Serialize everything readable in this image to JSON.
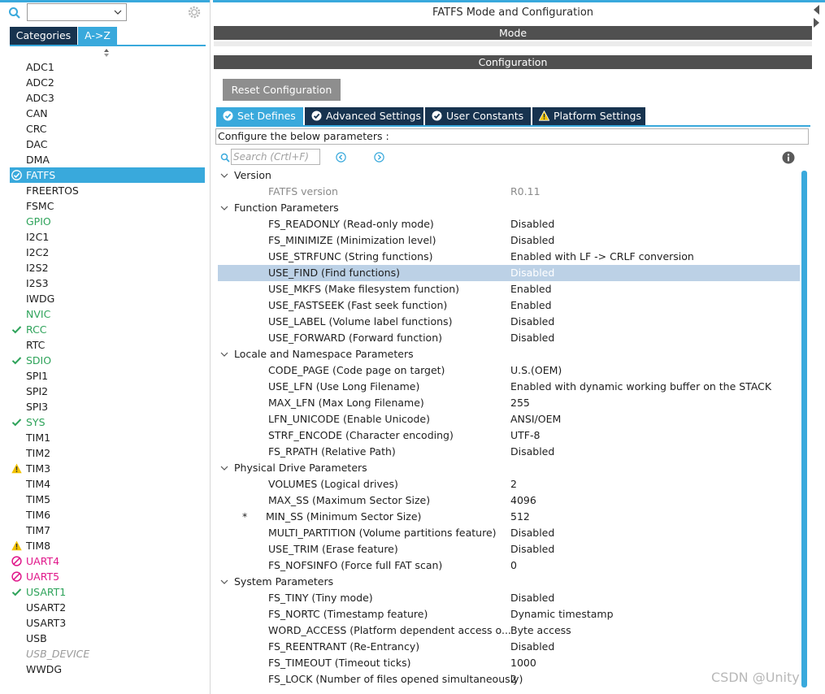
{
  "left_panel": {
    "search_value": "",
    "tabs": {
      "categories": "Categories",
      "az": "A->Z"
    },
    "items": [
      {
        "label": "ADC1",
        "status": "none",
        "style": "normal"
      },
      {
        "label": "ADC2",
        "status": "none",
        "style": "normal"
      },
      {
        "label": "ADC3",
        "status": "none",
        "style": "normal"
      },
      {
        "label": "CAN",
        "status": "none",
        "style": "normal"
      },
      {
        "label": "CRC",
        "status": "none",
        "style": "normal"
      },
      {
        "label": "DAC",
        "status": "none",
        "style": "normal"
      },
      {
        "label": "DMA",
        "status": "none",
        "style": "normal"
      },
      {
        "label": "FATFS",
        "status": "check",
        "style": "selected"
      },
      {
        "label": "FREERTOS",
        "status": "none",
        "style": "normal"
      },
      {
        "label": "FSMC",
        "status": "none",
        "style": "normal"
      },
      {
        "label": "GPIO",
        "status": "none",
        "style": "green"
      },
      {
        "label": "I2C1",
        "status": "none",
        "style": "normal"
      },
      {
        "label": "I2C2",
        "status": "none",
        "style": "normal"
      },
      {
        "label": "I2S2",
        "status": "none",
        "style": "normal"
      },
      {
        "label": "I2S3",
        "status": "none",
        "style": "normal"
      },
      {
        "label": "IWDG",
        "status": "none",
        "style": "normal"
      },
      {
        "label": "NVIC",
        "status": "none",
        "style": "green"
      },
      {
        "label": "RCC",
        "status": "check",
        "style": "green"
      },
      {
        "label": "RTC",
        "status": "none",
        "style": "normal"
      },
      {
        "label": "SDIO",
        "status": "check",
        "style": "green"
      },
      {
        "label": "SPI1",
        "status": "none",
        "style": "normal"
      },
      {
        "label": "SPI2",
        "status": "none",
        "style": "normal"
      },
      {
        "label": "SPI3",
        "status": "none",
        "style": "normal"
      },
      {
        "label": "SYS",
        "status": "check",
        "style": "green"
      },
      {
        "label": "TIM1",
        "status": "none",
        "style": "normal"
      },
      {
        "label": "TIM2",
        "status": "none",
        "style": "normal"
      },
      {
        "label": "TIM3",
        "status": "warning",
        "style": "normal"
      },
      {
        "label": "TIM4",
        "status": "none",
        "style": "normal"
      },
      {
        "label": "TIM5",
        "status": "none",
        "style": "normal"
      },
      {
        "label": "TIM6",
        "status": "none",
        "style": "normal"
      },
      {
        "label": "TIM7",
        "status": "none",
        "style": "normal"
      },
      {
        "label": "TIM8",
        "status": "warning",
        "style": "normal"
      },
      {
        "label": "UART4",
        "status": "blocked",
        "style": "pink"
      },
      {
        "label": "UART5",
        "status": "blocked",
        "style": "pink"
      },
      {
        "label": "USART1",
        "status": "check",
        "style": "green"
      },
      {
        "label": "USART2",
        "status": "none",
        "style": "normal"
      },
      {
        "label": "USART3",
        "status": "none",
        "style": "normal"
      },
      {
        "label": "USB",
        "status": "none",
        "style": "normal"
      },
      {
        "label": "USB_DEVICE",
        "status": "none",
        "style": "disabled"
      },
      {
        "label": "WWDG",
        "status": "none",
        "style": "normal"
      }
    ]
  },
  "right_panel": {
    "title": "FATFS Mode and Configuration",
    "mode_header": "Mode",
    "config_header": "Configuration",
    "reset_button": "Reset Configuration",
    "tabs": [
      {
        "label": "Set Defines",
        "icon": "check-circle-icon",
        "active": true
      },
      {
        "label": "Advanced Settings",
        "icon": "check-circle-icon",
        "active": false
      },
      {
        "label": "User Constants",
        "icon": "check-circle-icon",
        "active": false
      },
      {
        "label": "Platform Settings",
        "icon": "warning-icon",
        "active": false
      }
    ],
    "description": "Configure the below parameters :",
    "search_placeholder": "Search (Crtl+F)",
    "rows": [
      {
        "type": "group",
        "label": "Version"
      },
      {
        "type": "param",
        "label": "FATFS version",
        "value": "R0.11",
        "readonly": true
      },
      {
        "type": "group",
        "label": "Function Parameters"
      },
      {
        "type": "param",
        "label": "FS_READONLY (Read-only mode)",
        "value": "Disabled"
      },
      {
        "type": "param",
        "label": "FS_MINIMIZE (Minimization level)",
        "value": "Disabled"
      },
      {
        "type": "param",
        "label": "USE_STRFUNC (String functions)",
        "value": "Enabled with LF -> CRLF conversion"
      },
      {
        "type": "param",
        "label": "USE_FIND (Find functions)",
        "value": "Disabled",
        "highlighted": true
      },
      {
        "type": "param",
        "label": "USE_MKFS (Make filesystem function)",
        "value": "Enabled"
      },
      {
        "type": "param",
        "label": "USE_FASTSEEK (Fast seek function)",
        "value": "Enabled"
      },
      {
        "type": "param",
        "label": "USE_LABEL (Volume label functions)",
        "value": "Disabled"
      },
      {
        "type": "param",
        "label": "USE_FORWARD (Forward function)",
        "value": "Disabled"
      },
      {
        "type": "group",
        "label": "Locale and Namespace Parameters"
      },
      {
        "type": "param",
        "label": "CODE_PAGE (Code page on target)",
        "value": "U.S.(OEM)"
      },
      {
        "type": "param",
        "label": "USE_LFN (Use Long Filename)",
        "value": "Enabled with dynamic working buffer on the STACK"
      },
      {
        "type": "param",
        "label": "MAX_LFN (Max Long Filename)",
        "value": "255"
      },
      {
        "type": "param",
        "label": "LFN_UNICODE (Enable Unicode)",
        "value": "ANSI/OEM"
      },
      {
        "type": "param",
        "label": "STRF_ENCODE (Character encoding)",
        "value": "UTF-8"
      },
      {
        "type": "param",
        "label": "FS_RPATH (Relative Path)",
        "value": "Disabled"
      },
      {
        "type": "group",
        "label": "Physical Drive Parameters"
      },
      {
        "type": "param",
        "label": "VOLUMES (Logical drives)",
        "value": "2"
      },
      {
        "type": "param",
        "label": "MAX_SS (Maximum Sector Size)",
        "value": "4096"
      },
      {
        "type": "param",
        "label": "MIN_SS (Minimum Sector Size)",
        "value": "512",
        "modified": "*"
      },
      {
        "type": "param",
        "label": "MULTI_PARTITION (Volume partitions feature)",
        "value": "Disabled"
      },
      {
        "type": "param",
        "label": "USE_TRIM (Erase feature)",
        "value": "Disabled"
      },
      {
        "type": "param",
        "label": "FS_NOFSINFO (Force full FAT scan)",
        "value": "0"
      },
      {
        "type": "group",
        "label": "System Parameters"
      },
      {
        "type": "param",
        "label": "FS_TINY (Tiny mode)",
        "value": "Disabled"
      },
      {
        "type": "param",
        "label": "FS_NORTC (Timestamp feature)",
        "value": "Dynamic timestamp"
      },
      {
        "type": "param",
        "label": "WORD_ACCESS (Platform dependent access o...",
        "value": "Byte access"
      },
      {
        "type": "param",
        "label": "FS_REENTRANT (Re-Entrancy)",
        "value": "Disabled"
      },
      {
        "type": "param",
        "label": "FS_TIMEOUT (Timeout ticks)",
        "value": "1000"
      },
      {
        "type": "param",
        "label": "FS_LOCK (Number of files opened simultaneously)",
        "value": "2"
      }
    ]
  },
  "watermark": "CSDN @Unity",
  "colors": {
    "accent": "#39a9dc",
    "tab_dark": "#17334f",
    "header_grey": "#505050",
    "ok_green": "#2ea35a",
    "error_pink": "#e0178a",
    "highlight_row": "#bcd1e6"
  }
}
